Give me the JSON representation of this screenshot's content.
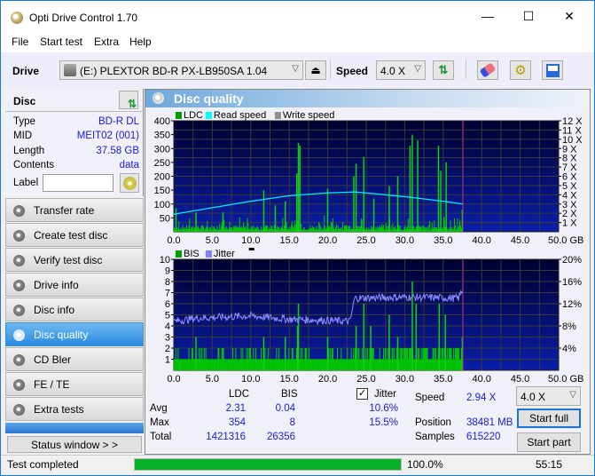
{
  "window": {
    "title": "Opti Drive Control 1.70",
    "controls": {
      "minimize": "—",
      "maximize": "☐",
      "close": "✕"
    }
  },
  "menu": [
    "File",
    "Start test",
    "Extra",
    "Help"
  ],
  "toolbar": {
    "drive_label": "Drive",
    "drive_value": "(E:)  PLEXTOR BD-R  PX-LB950SA 1.04",
    "speed_label": "Speed",
    "speed_value": "4.0 X",
    "icons": [
      "eject-icon",
      "refresh-icon",
      "erase-icon",
      "settings-icon",
      "save-icon"
    ]
  },
  "disc": {
    "header": "Disc",
    "fields": [
      {
        "key": "Type",
        "value": "BD-R DL"
      },
      {
        "key": "MID",
        "value": "MEIT02 (001)"
      },
      {
        "key": "Length",
        "value": "37.58 GB"
      },
      {
        "key": "Contents",
        "value": "data"
      }
    ],
    "label_key": "Label",
    "label_value": ""
  },
  "nav": [
    {
      "label": "Transfer rate",
      "active": false
    },
    {
      "label": "Create test disc",
      "active": false
    },
    {
      "label": "Verify test disc",
      "active": false
    },
    {
      "label": "Drive info",
      "active": false
    },
    {
      "label": "Disc info",
      "active": false
    },
    {
      "label": "Disc quality",
      "active": true
    },
    {
      "label": "CD Bler",
      "active": false
    },
    {
      "label": "FE / TE",
      "active": false
    },
    {
      "label": "Extra tests",
      "active": false
    }
  ],
  "status_window_label": "Status window > >",
  "panel_title": "Disc quality",
  "chart_data": [
    {
      "type": "bar",
      "title": "LDC / Read speed",
      "legend": [
        "LDC",
        "Read speed",
        "Write speed"
      ],
      "legend_colors": [
        "#00a000",
        "#00ffff",
        "#909090"
      ],
      "xlabel": "GB",
      "x_ticks": [
        "0.0",
        "5.0",
        "10.0",
        "15.0",
        "20.0",
        "25.0",
        "30.0",
        "35.0",
        "40.0",
        "45.0",
        "50.0 GB"
      ],
      "xlim": [
        0,
        50
      ],
      "y_ticks": [
        "400",
        "350",
        "300",
        "250",
        "200",
        "150",
        "100",
        "50"
      ],
      "ylim": [
        0,
        400
      ],
      "y2_ticks": [
        "12 X",
        "11 X",
        "10 X",
        "9 X",
        "8 X",
        "7 X",
        "6 X",
        "5 X",
        "4 X",
        "3 X",
        "2 X",
        "1 X"
      ],
      "y2lim": [
        0,
        12
      ],
      "data_end_gb": 37.58,
      "ldc_peaks": [
        {
          "x": 0.2,
          "y": 85
        },
        {
          "x": 2.8,
          "y": 70
        },
        {
          "x": 6.3,
          "y": 70
        },
        {
          "x": 11.6,
          "y": 150
        },
        {
          "x": 13.1,
          "y": 95
        },
        {
          "x": 14.4,
          "y": 110
        },
        {
          "x": 15.9,
          "y": 210
        },
        {
          "x": 16.1,
          "y": 320
        },
        {
          "x": 16.3,
          "y": 310
        },
        {
          "x": 19.9,
          "y": 155
        },
        {
          "x": 23.3,
          "y": 200
        },
        {
          "x": 23.6,
          "y": 245
        },
        {
          "x": 24.6,
          "y": 270
        },
        {
          "x": 25.9,
          "y": 120
        },
        {
          "x": 27.9,
          "y": 165
        },
        {
          "x": 29.0,
          "y": 200
        },
        {
          "x": 30.6,
          "y": 310
        },
        {
          "x": 30.9,
          "y": 350
        },
        {
          "x": 31.6,
          "y": 330
        },
        {
          "x": 34.3,
          "y": 310
        },
        {
          "x": 34.6,
          "y": 220
        },
        {
          "x": 35.3,
          "y": 250
        },
        {
          "x": 37.4,
          "y": 80
        }
      ],
      "read_speed_x": [
        0,
        5,
        10,
        15,
        20,
        23.5,
        25,
        30,
        35,
        37.58
      ],
      "read_speed_y": [
        1.9,
        2.6,
        3.3,
        3.9,
        4.2,
        4.3,
        4.2,
        3.8,
        3.3,
        3.0
      ]
    },
    {
      "type": "bar",
      "title": "BIS / Jitter",
      "legend": [
        "BIS",
        "Jitter"
      ],
      "legend_colors": [
        "#00a000",
        "#8080ff"
      ],
      "xlabel": "GB",
      "x_ticks": [
        "0.0",
        "5.0",
        "10.0",
        "15.0",
        "20.0",
        "25.0",
        "30.0",
        "35.0",
        "40.0",
        "45.0",
        "50.0 GB"
      ],
      "xlim": [
        0,
        50
      ],
      "y_ticks": [
        "10",
        "9",
        "8",
        "7",
        "6",
        "5",
        "4",
        "3",
        "2",
        "1"
      ],
      "ylim": [
        0,
        10
      ],
      "y2_ticks": [
        "20%",
        "16%",
        "12%",
        "8%",
        "4%"
      ],
      "y2lim": [
        0,
        20
      ],
      "data_end_gb": 37.58,
      "bis_peaks": [
        {
          "x": 2.8,
          "y": 3
        },
        {
          "x": 11.6,
          "y": 3
        },
        {
          "x": 14.4,
          "y": 3
        },
        {
          "x": 16.0,
          "y": 4
        },
        {
          "x": 16.1,
          "y": 6
        },
        {
          "x": 19.9,
          "y": 3
        },
        {
          "x": 23.6,
          "y": 4
        },
        {
          "x": 24.6,
          "y": 6
        },
        {
          "x": 25.5,
          "y": 4
        },
        {
          "x": 27.9,
          "y": 5
        },
        {
          "x": 29.0,
          "y": 3
        },
        {
          "x": 30.9,
          "y": 8
        },
        {
          "x": 31.4,
          "y": 6
        },
        {
          "x": 34.4,
          "y": 6
        },
        {
          "x": 35.2,
          "y": 5
        },
        {
          "x": 37.4,
          "y": 3
        }
      ],
      "jitter_x": [
        0,
        3,
        10,
        15,
        20,
        22.9,
        23.5,
        30,
        37,
        37.5
      ],
      "jitter_y": [
        8.8,
        9.4,
        9.8,
        9.2,
        9.0,
        8.8,
        13.0,
        13.2,
        13.0,
        14.5
      ]
    }
  ],
  "stats": {
    "col_ldc": "LDC",
    "col_bis": "BIS",
    "jitter_label": "Jitter",
    "jitter_checked": true,
    "rows": [
      {
        "label": "Avg",
        "ldc": "2.31",
        "bis": "0.04",
        "jitter": "10.6%"
      },
      {
        "label": "Max",
        "ldc": "354",
        "bis": "8",
        "jitter": "15.5%"
      },
      {
        "label": "Total",
        "ldc": "1421316",
        "bis": "26356",
        "jitter": ""
      }
    ],
    "speed_label": "Speed",
    "speed_value": "2.94 X",
    "position_label": "Position",
    "position_value": "38481 MB",
    "samples_label": "Samples",
    "samples_value": "615220",
    "speed_select": "4.0 X",
    "start_full": "Start full",
    "start_part": "Start part"
  },
  "statusbar": {
    "text": "Test completed",
    "progress": 100.0,
    "progress_text": "100.0%",
    "time": "55:15"
  }
}
